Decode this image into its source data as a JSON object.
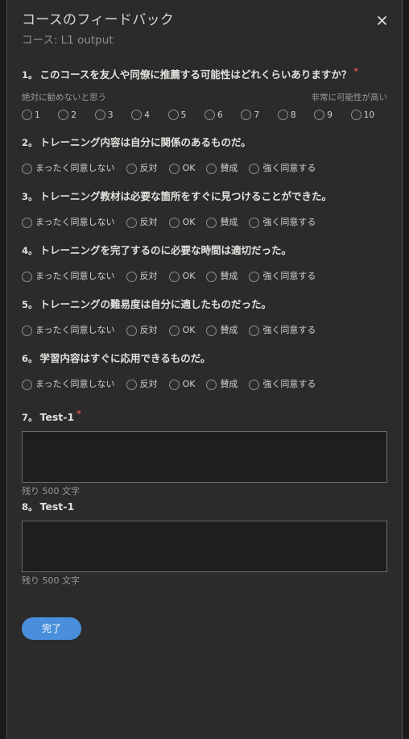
{
  "modal": {
    "title": "コースのフィードバック",
    "subtitle": "コース: L1 output",
    "close_icon": "close-icon"
  },
  "nps": {
    "number": "1。",
    "text": "このコースを友人や同僚に推薦する可能性はどれくらいありますか？",
    "required_marker": "*",
    "low_label": "絶対に勧めないと思う",
    "high_label": "非常に可能性が高い",
    "options": [
      "1",
      "2",
      "3",
      "4",
      "5",
      "6",
      "7",
      "8",
      "9",
      "10"
    ]
  },
  "likert_options": [
    "まったく同意しない",
    "反対",
    "OK",
    "賛成",
    "強く同意する"
  ],
  "likert_questions": [
    {
      "number": "2。",
      "text": "トレーニング内容は自分に関係のあるものだ。"
    },
    {
      "number": "3。",
      "text": "トレーニング教材は必要な箇所をすぐに見つけることができた。"
    },
    {
      "number": "4。",
      "text": "トレーニングを完了するのに必要な時間は適切だった。"
    },
    {
      "number": "5。",
      "text": "トレーニングの難易度は自分に適したものだった。"
    },
    {
      "number": "6。",
      "text": "学習内容はすぐに応用できるものだ。"
    }
  ],
  "text_questions": [
    {
      "number": "7。",
      "text": "Test-1",
      "required_marker": "*",
      "value": "",
      "counter": "残り 500 文字"
    },
    {
      "number": "8。",
      "text": "Test-1",
      "value": "",
      "counter": "残り 500 文字"
    }
  ],
  "footer": {
    "submit_label": "完了"
  },
  "colors": {
    "accent": "#4a8fdb",
    "required": "#d9534f",
    "modal_bg": "#2b2b2b",
    "page_bg": "#1b1b1b"
  }
}
